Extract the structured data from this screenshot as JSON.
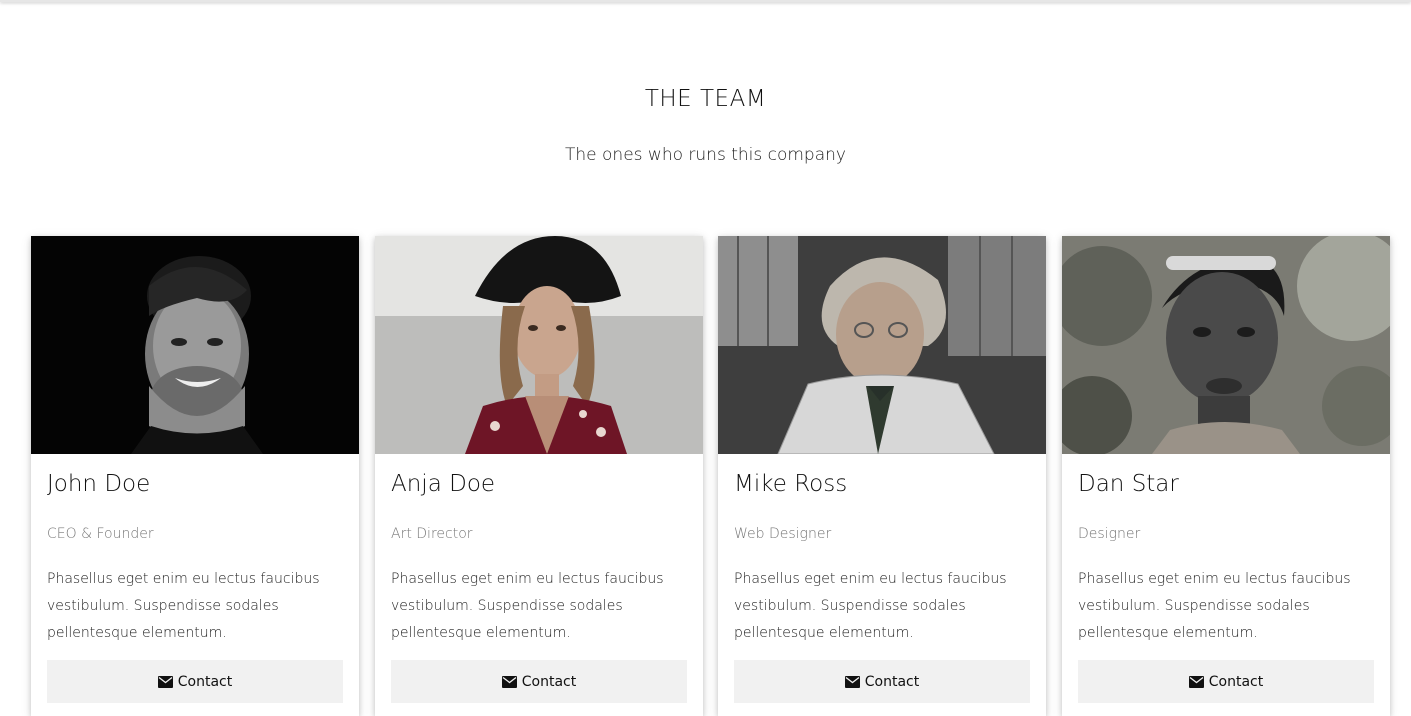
{
  "header": {
    "title": "THE TEAM",
    "subtitle": "The ones who runs this company"
  },
  "members": [
    {
      "name": "John Doe",
      "role": "CEO & Founder",
      "description": "Phasellus eget enim eu lectus faucibus vestibulum. Suspendisse sodales pellentesque elementum.",
      "contact_label": "Contact"
    },
    {
      "name": "Anja Doe",
      "role": "Art Director",
      "description": "Phasellus eget enim eu lectus faucibus vestibulum. Suspendisse sodales pellentesque elementum.",
      "contact_label": "Contact"
    },
    {
      "name": "Mike Ross",
      "role": "Web Designer",
      "description": "Phasellus eget enim eu lectus faucibus vestibulum. Suspendisse sodales pellentesque elementum.",
      "contact_label": "Contact"
    },
    {
      "name": "Dan Star",
      "role": "Designer",
      "description": "Phasellus eget enim eu lectus faucibus vestibulum. Suspendisse sodales pellentesque elementum.",
      "contact_label": "Contact"
    }
  ],
  "icons": {
    "contact": "envelope-icon"
  },
  "colors": {
    "button_bg": "#f1f1f1",
    "role_text": "#777777"
  }
}
